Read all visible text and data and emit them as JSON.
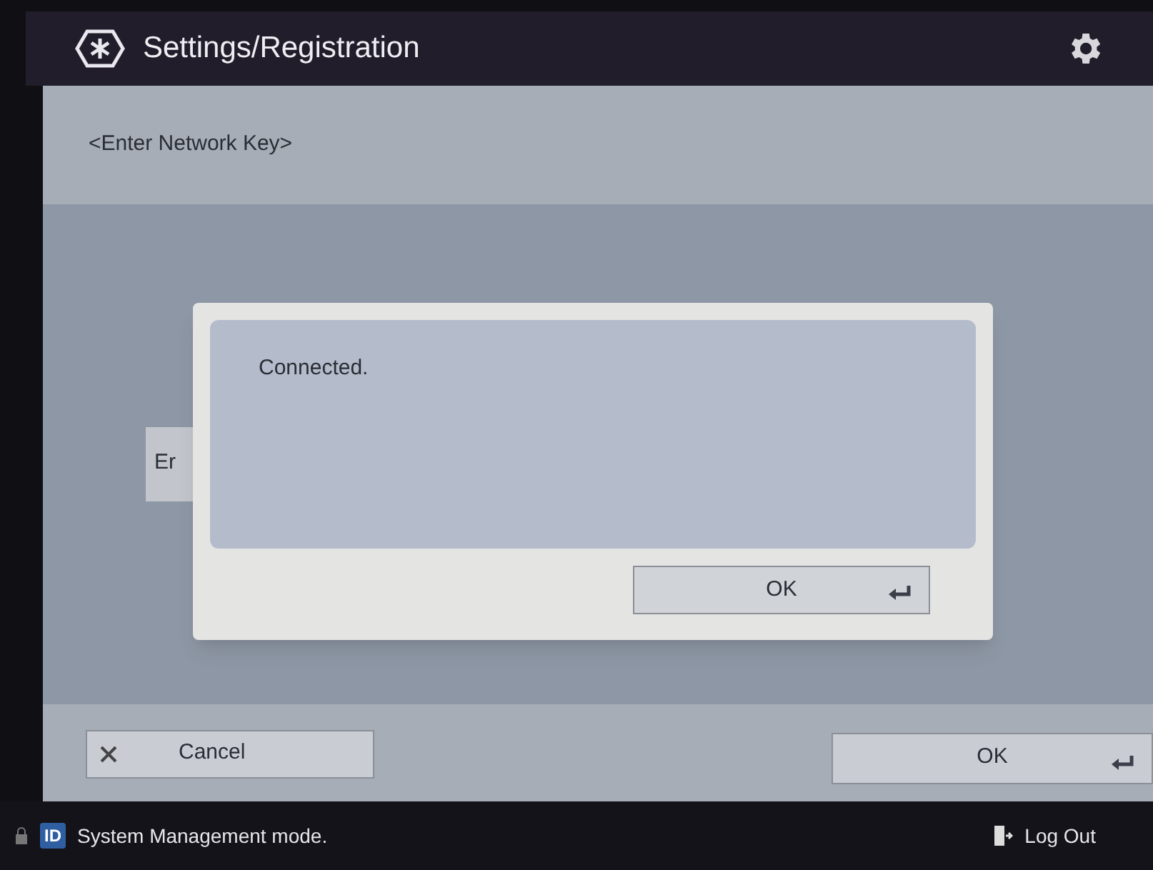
{
  "header": {
    "title": "Settings/Registration"
  },
  "screen": {
    "heading": "<Enter Network Key>",
    "field_label": "Er"
  },
  "dialog": {
    "message": "Connected.",
    "ok_button": "OK"
  },
  "footer": {
    "cancel_button": "Cancel",
    "ok_button": "OK"
  },
  "status_bar": {
    "id_badge": "ID",
    "mode": "System Management mode.",
    "logout": "Log Out"
  }
}
